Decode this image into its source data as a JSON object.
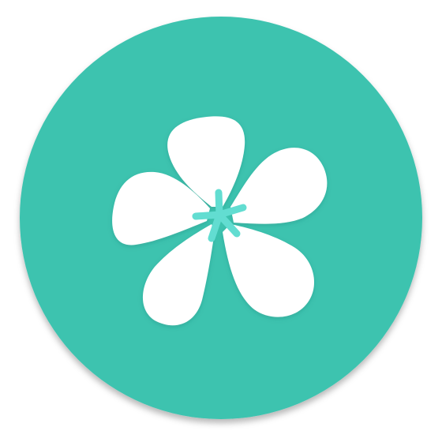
{
  "icon": {
    "name": "flower-app-icon",
    "colors": {
      "background_circle": "#3DC3AF",
      "background_shadow": "#2A9E8C",
      "petals": "#FFFFFF",
      "petal_shading": "#E9F4F2",
      "pistil": "#62DDD1"
    },
    "petal_count": 5
  }
}
